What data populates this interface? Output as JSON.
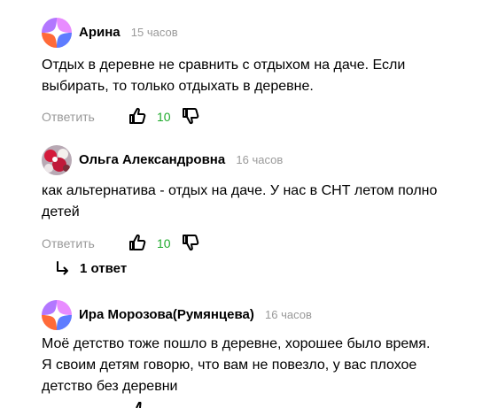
{
  "colors": {
    "like_count": "#1eaa2b",
    "muted": "#999999",
    "text": "#000000"
  },
  "comments": [
    {
      "avatar": "yandex-zen-avatar-icon",
      "author": "Арина",
      "time": "15 часов",
      "text": "Отдых в деревне не сравнить с отдыхом на даче. Если\nвыбирать, то только отдыхать в деревне.",
      "reply_label": "Ответить",
      "likes": "10"
    },
    {
      "avatar": "photo-avatar",
      "author": "Ольга Александровна",
      "time": "16 часов",
      "text": "как альтернатива - отдых на даче. У нас в СНТ летом полно\nдетей",
      "reply_label": "Ответить",
      "likes": "10",
      "replies_label": "1 ответ"
    },
    {
      "avatar": "yandex-zen-avatar-icon",
      "author": "Ира Морозова(Румянцева)",
      "time": "16 часов",
      "text": "Моё детство тоже пошло в деревне, хорошее было время.\nЯ своим детям говорю, что вам не повезло, у вас плохое\nдетство без деревни"
    }
  ]
}
